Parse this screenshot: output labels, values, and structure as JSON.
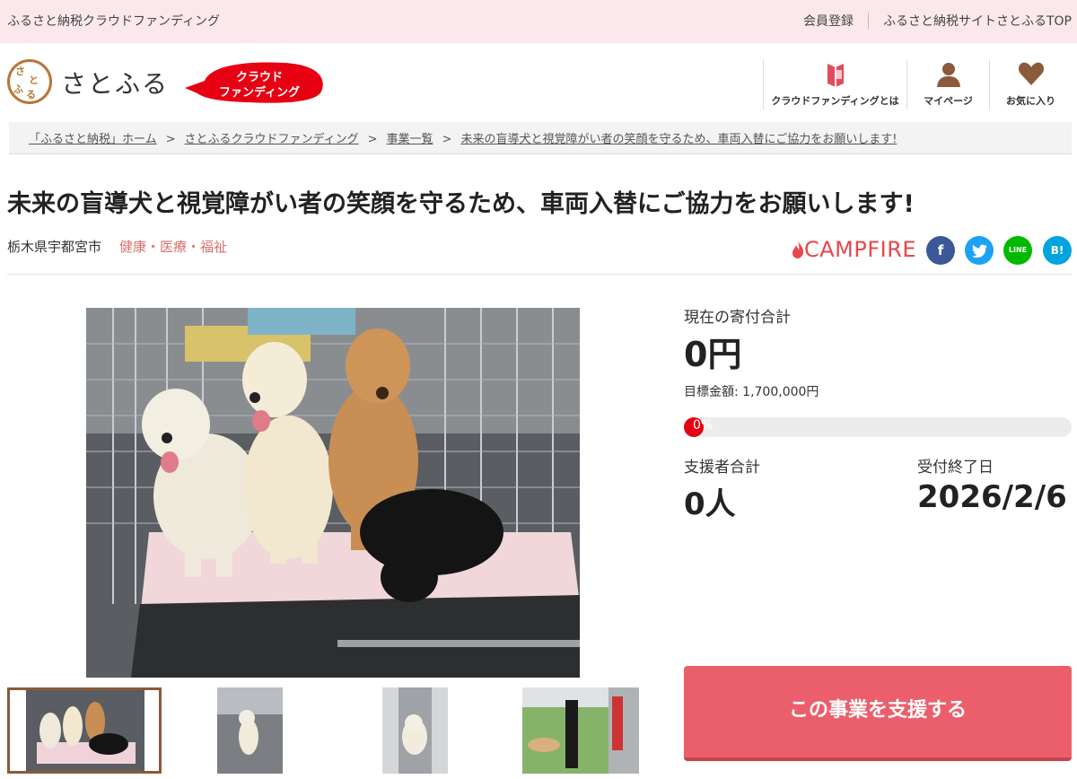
{
  "topbar": {
    "site_name": "ふるさと納税クラウドファンディング",
    "member_register": "会員登録",
    "top_link": "ふるさと納税サイトさとふるTOP"
  },
  "header": {
    "logo_text": "さとふる",
    "seal_chars": [
      "さ",
      "と",
      "ふ",
      "る"
    ],
    "badge_line1": "クラウド",
    "badge_line2": "ファンディング",
    "nav": [
      {
        "label": "クラウドファンディングとは",
        "icon": "book-icon"
      },
      {
        "label": "マイページ",
        "icon": "user-icon"
      },
      {
        "label": "お気に入り",
        "icon": "heart-icon"
      }
    ]
  },
  "breadcrumb": {
    "items": [
      "「ふるさと納税」ホーム",
      "さとふるクラウドファンディング",
      "事業一覧",
      "未来の盲導犬と視覚障がい者の笑顔を守るため、車両入替にご協力をお願いします!"
    ],
    "separator": ">"
  },
  "project": {
    "title": "未来の盲導犬と視覚障がい者の笑顔を守るため、車両入替にご協力をお願いします!",
    "location": "栃木県宇都宮市",
    "category": "健康・医療・福祉",
    "partner": "CAMPFIRE"
  },
  "share": {
    "facebook": "f",
    "twitter": "t",
    "line": "LINE",
    "hatena": "B!"
  },
  "colors": {
    "accent": "#ea5f6b",
    "topbar_bg": "#fbe8ec",
    "progress_fill": "#e60012",
    "facebook": "#3b5998",
    "twitter": "#1da1f2",
    "line": "#00b900",
    "hatena": "#00a4de"
  },
  "stats": {
    "total_label": "現在の寄付合計",
    "total_value": "0円",
    "goal_text": "目標金額: 1,700,000円",
    "progress_percent": 0,
    "progress_text": "0%",
    "supporters_label": "支援者合計",
    "supporters_value": "0人",
    "deadline_label": "受付終了日",
    "deadline_value": "2026/2/6"
  },
  "cta": {
    "label": "この事業を支援する"
  }
}
